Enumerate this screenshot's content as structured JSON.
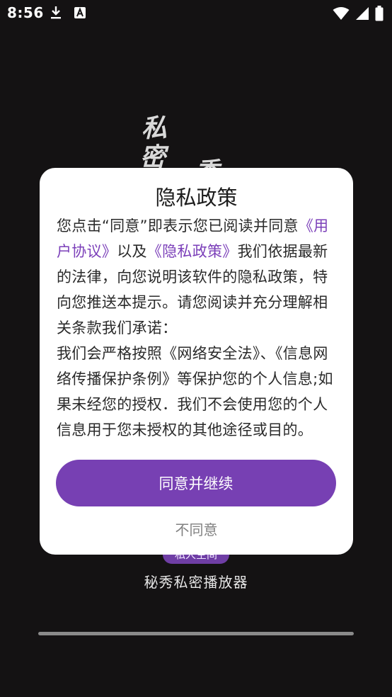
{
  "status_bar": {
    "time": "8:56",
    "left_icons": [
      "download-icon",
      "app-notification-icon"
    ],
    "right_icons": [
      "wifi-icon",
      "cellular-signal-icon",
      "battery-icon"
    ]
  },
  "background": {
    "calligraphy": [
      "私",
      "密",
      "秀"
    ],
    "tag_label": "私人空间",
    "app_name": "秘秀私密播放器"
  },
  "dialog": {
    "title": "隐私政策",
    "body": {
      "intro": "您点击“同意”即表示您已阅读并同意",
      "user_agreement_link": "《用户协议》",
      "conjunction": "以及",
      "privacy_policy_link": "《隐私政策》",
      "paragraph_1_rest": "我们依据最新的法律，向您说明该软件的隐私政策，特向您推送本提示。请您阅读并充分理解相关条款我们承诺：",
      "paragraph_2": "我们会严格按照《网络安全法》、《信息网络传播保护条例》等保护您的个人信息;如果未经您的授权．我们不会使用您的个人信息用于您未授权的其他途径或目的。"
    },
    "agree_button": "同意并继续",
    "disagree_button": "不同意"
  },
  "colors": {
    "accent": "#7740b3",
    "link": "#7b3fb9",
    "background": "#141213",
    "dialog_bg": "#ffffff"
  }
}
